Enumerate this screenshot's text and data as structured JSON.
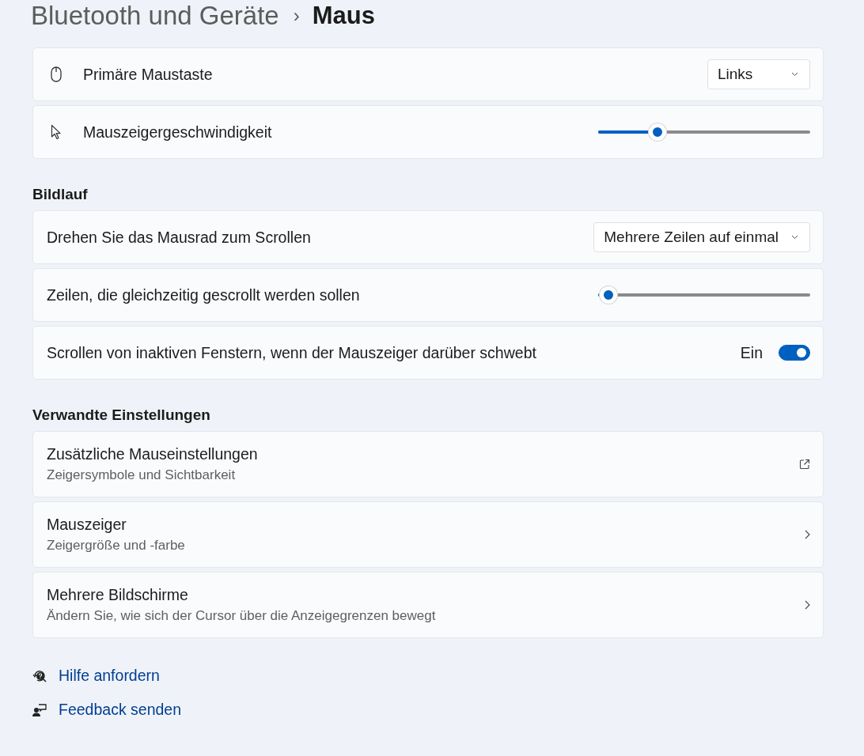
{
  "breadcrumb": {
    "parent": "Bluetooth und Geräte",
    "separator": "›",
    "current": "Maus"
  },
  "groups": [
    {
      "rows": [
        {
          "kind": "dropdown",
          "label": "Primäre Maustaste",
          "value": "Links"
        },
        {
          "kind": "slider",
          "label": "Mauszeigergeschwindigkeit",
          "level": 0.28
        }
      ]
    },
    {
      "heading": "Bildlauf",
      "rows": [
        {
          "kind": "dropdown",
          "label": "Drehen Sie das Mausrad zum Scrollen",
          "value": "Mehrere Zeilen auf einmal"
        },
        {
          "kind": "slider",
          "label": "Zeilen, die gleichzeitig gescrollt werden sollen",
          "level": 0.05
        },
        {
          "kind": "toggle",
          "label": "Scrollen von inaktiven Fenstern, wenn der Mauszeiger darüber schwebt",
          "state_text": "Ein",
          "on": true
        }
      ]
    },
    {
      "heading": "Verwandte Einstellungen",
      "rows": [
        {
          "kind": "external",
          "label": "Zusätzliche Mauseinstellungen",
          "description": "Zeigersymbole und Sichtbarkeit"
        },
        {
          "kind": "nav",
          "label": "Mauszeiger",
          "description": "Zeigergröße und -farbe"
        },
        {
          "kind": "nav",
          "label": "Mehrere Bildschirme",
          "description": "Ändern Sie, wie sich der Cursor über die Anzeigegrenzen bewegt"
        }
      ]
    }
  ],
  "links": [
    {
      "label": "Hilfe anfordern"
    },
    {
      "label": "Feedback senden"
    }
  ]
}
